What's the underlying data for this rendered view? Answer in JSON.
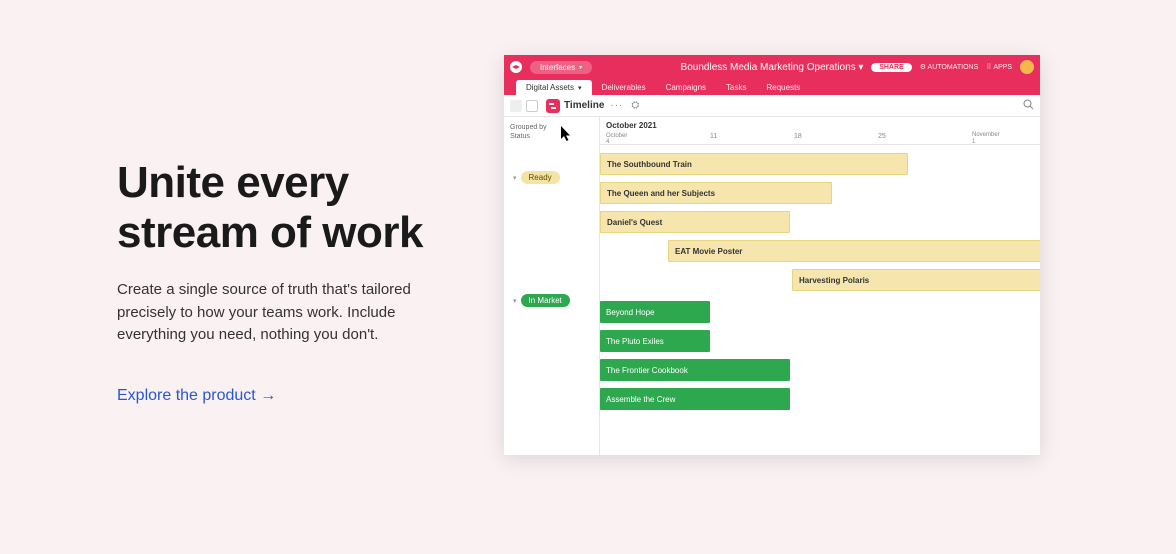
{
  "hero": {
    "headline_l1": "Unite every",
    "headline_l2": "stream of work",
    "body": "Create a single source of truth that's tailored precisely to how your teams work. Include everything you need, nothing you don't.",
    "cta": "Explore the product →"
  },
  "topbar": {
    "interfaces": "Interfaces",
    "title": "Boundless Media Marketing Operations ▾",
    "share": "SHARE",
    "automations": "⚙ AUTOMATIONS",
    "apps": "⠿ APPS"
  },
  "tabs": [
    "Digital Assets",
    "Deliverables",
    "Campaigns",
    "Tasks",
    "Requests"
  ],
  "viewbar": {
    "title": "Timeline",
    "dots": "···"
  },
  "grouping": {
    "label_l1": "Grouped by",
    "label_l2": "Status",
    "ready": "Ready",
    "in_market": "In Market"
  },
  "timeline": {
    "month": "October 2021",
    "sub_month": "October",
    "ticks": [
      "4",
      "11",
      "18",
      "25"
    ],
    "nov_l1": "November",
    "nov_l2": "1"
  },
  "bars": {
    "ready": [
      "The Southbound Train",
      "The Queen and her Subjects",
      "Daniel's Quest",
      "EAT Movie Poster",
      "Harvesting Polaris"
    ],
    "market": [
      "Beyond Hope",
      "The Pluto Exiles",
      "The Frontier Cookbook",
      "Assemble the Crew"
    ]
  }
}
